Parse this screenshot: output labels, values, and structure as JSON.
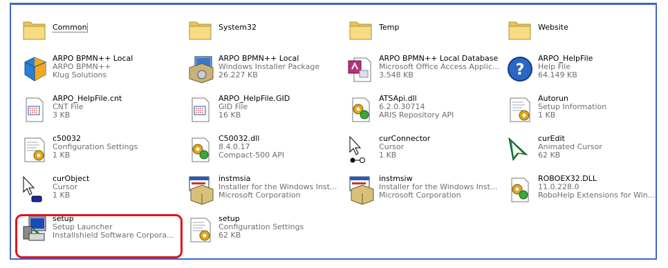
{
  "colors": {
    "frame_border": "#3d64c8",
    "highlight": "#e0121c",
    "secondary_text": "#6e6e6e"
  },
  "items": [
    {
      "icon": "folder-icon",
      "name": "Common"
    },
    {
      "icon": "folder-icon",
      "name": "System32"
    },
    {
      "icon": "folder-icon",
      "name": "Temp"
    },
    {
      "icon": "folder-icon",
      "name": "Website"
    },
    {
      "icon": "cube-application-icon",
      "name": "ARPO BPMN++ Local",
      "line2": "ARPO BPMN++",
      "line3": "Klug Solutions"
    },
    {
      "icon": "installer-package-icon",
      "name": "ARPO BPMN++ Local",
      "line2": "Windows Installer Package",
      "line3": "26.227 KB"
    },
    {
      "icon": "access-database-icon",
      "name": "ARPO BPMN++ Local Database",
      "line2": "Microsoft Office Access Applic...",
      "line3": "3.548 KB"
    },
    {
      "icon": "help-file-icon",
      "name": "ARPO_HelpFile",
      "line2": "Help File",
      "line3": "64.149 KB"
    },
    {
      "icon": "cnt-file-icon",
      "name": "ARPO_HelpFile.cnt",
      "line2": "CNT File",
      "line3": "3 KB"
    },
    {
      "icon": "gid-file-icon",
      "name": "ARPO_HelpFile.GID",
      "line2": "GID File",
      "line3": "16 KB"
    },
    {
      "icon": "dll-gear-icon",
      "name": "ATSApi.dll",
      "line2": "6.2.0.30714",
      "line3": "ARIS Repository API"
    },
    {
      "icon": "setup-information-icon",
      "name": "Autorun",
      "line2": "Setup Information",
      "line3": "1 KB"
    },
    {
      "icon": "config-settings-icon",
      "name": "c50032",
      "line2": "Configuration Settings",
      "line3": "1 KB"
    },
    {
      "icon": "dll-gear-icon",
      "name": "C50032.dll",
      "line2": "8.4.0.17",
      "line3": "Compact-500 API"
    },
    {
      "icon": "cursor-connector-icon",
      "name": "curConnector",
      "line2": "Cursor",
      "line3": "1 KB"
    },
    {
      "icon": "animated-cursor-icon",
      "name": "curEdit",
      "line2": "Animated Cursor",
      "line3": "62 KB"
    },
    {
      "icon": "cursor-object-icon",
      "name": "curObject",
      "line2": "Cursor",
      "line3": "1 KB"
    },
    {
      "icon": "installer-window-icon",
      "name": "instmsia",
      "line2": "Installer for the Windows Inst...",
      "line3": "Microsoft Corporation"
    },
    {
      "icon": "installer-window-icon",
      "name": "instmsiw",
      "line2": "Installer for the Windows Inst...",
      "line3": "Microsoft Corporation"
    },
    {
      "icon": "dll-gear-icon",
      "name": "ROBOEX32.DLL",
      "line2": "11.0.228.0",
      "line3": "RoboHelp Extensions for WinH..."
    },
    {
      "icon": "setup-launcher-icon",
      "name": "setup",
      "line2": "Setup Launcher",
      "line3": "Installshield Software Corpora..."
    },
    {
      "icon": "config-settings-icon",
      "name": "setup",
      "line2": "Configuration Settings",
      "line3": "62 KB"
    }
  ]
}
